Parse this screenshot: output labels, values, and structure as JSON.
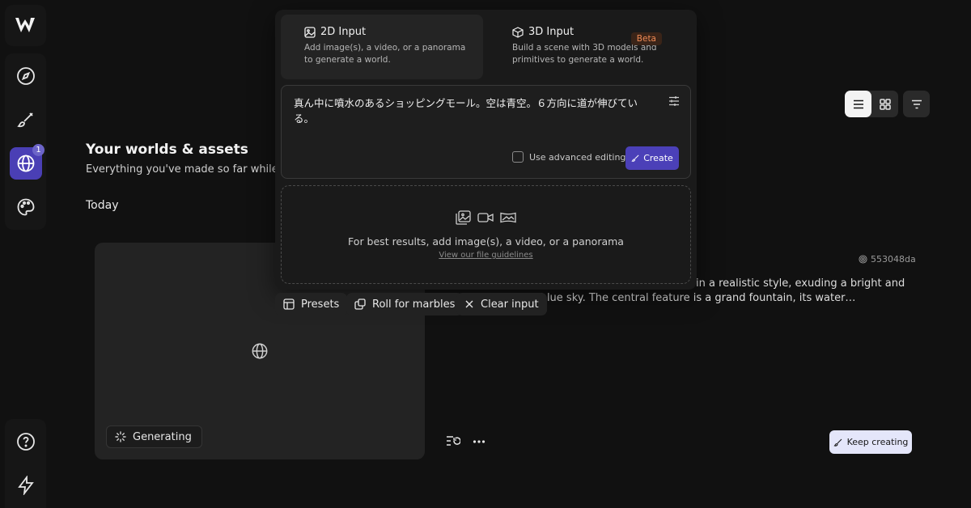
{
  "sidebar": {
    "logo": "brand-logo",
    "items": [
      {
        "id": "explore",
        "icon": "compass-icon"
      },
      {
        "id": "create",
        "icon": "brush-icon"
      },
      {
        "id": "worlds",
        "icon": "globe-icon",
        "badge": "1",
        "active": true
      },
      {
        "id": "assets",
        "icon": "palette-icon"
      }
    ],
    "bottom": [
      {
        "id": "help",
        "icon": "help-icon"
      },
      {
        "id": "upgrade",
        "icon": "lightning-icon"
      }
    ]
  },
  "page": {
    "heading": "Your worlds & assets",
    "subheading": "Everything you've made so far while crea",
    "section": "Today"
  },
  "card": {
    "status": "Generating",
    "hash": "553048da",
    "description_line1": "in a realistic style, exuding a bright and",
    "description_line2": "re under a clear blue sky. The central feature is a grand fountain, its water…"
  },
  "actions": {
    "keep_creating": "Keep creating"
  },
  "overlay": {
    "tabs": [
      {
        "label": "2D Input",
        "description_1": "Add image(s), a video, or a panorama",
        "description_2": "to generate a world.",
        "selected": true
      },
      {
        "label": "3D Input",
        "description_1": "Build a scene with 3D models and",
        "description_2": "primitives to generate a world.",
        "badge": "Beta"
      }
    ],
    "prompt_line1": "真ん中に噴水のあるショッピングモール。空は青空。６方向に道が伸びてい",
    "prompt_line2": "る。",
    "advanced_label": "Use advanced editing",
    "create_label": "Create",
    "drop_text": "For best results, add image(s), a video, or a panorama",
    "guidelines_link": "View our file guidelines"
  },
  "pills": {
    "presets": "Presets",
    "roll": "Roll for marbles",
    "clear": "Clear input"
  },
  "colors": {
    "background": "#111111",
    "accent": "#4b40b8",
    "beta": "#f08a55"
  }
}
